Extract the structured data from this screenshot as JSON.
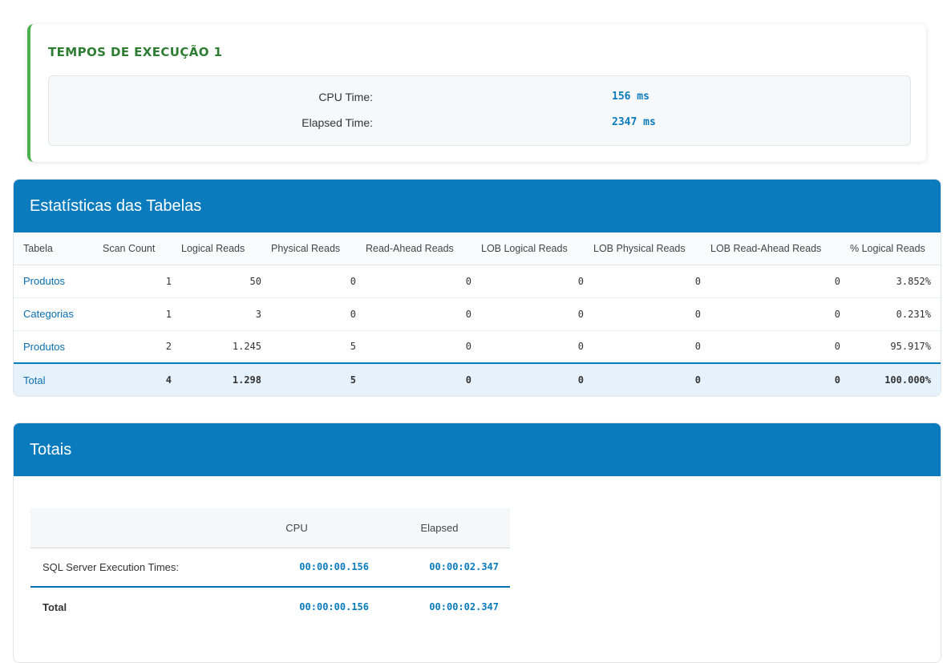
{
  "exec": {
    "title": "TEMPOS DE EXECUÇÃO 1",
    "rows": [
      {
        "label": "CPU Time:",
        "value": "156 ms"
      },
      {
        "label": "Elapsed Time:",
        "value": "2347 ms"
      }
    ]
  },
  "stats": {
    "title": "Estatísticas das Tabelas",
    "headers": [
      "Tabela",
      "Scan Count",
      "Logical Reads",
      "Physical Reads",
      "Read-Ahead Reads",
      "LOB Logical Reads",
      "LOB Physical Reads",
      "LOB Read-Ahead Reads",
      "% Logical Reads"
    ],
    "rows": [
      [
        "Produtos",
        "1",
        "50",
        "0",
        "0",
        "0",
        "0",
        "0",
        "3.852%"
      ],
      [
        "Categorias",
        "1",
        "3",
        "0",
        "0",
        "0",
        "0",
        "0",
        "0.231%"
      ],
      [
        "Produtos",
        "2",
        "1.245",
        "5",
        "0",
        "0",
        "0",
        "0",
        "95.917%"
      ]
    ],
    "total": [
      "Total",
      "4",
      "1.298",
      "5",
      "0",
      "0",
      "0",
      "0",
      "100.000%"
    ]
  },
  "totals": {
    "title": "Totais",
    "headers": [
      "",
      "CPU",
      "Elapsed"
    ],
    "rows": [
      {
        "label": "SQL Server Execution Times:",
        "cpu": "00:00:00.156",
        "elapsed": "00:00:02.347"
      }
    ],
    "total": {
      "label": "Total",
      "cpu": "00:00:00.156",
      "elapsed": "00:00:02.347"
    }
  }
}
